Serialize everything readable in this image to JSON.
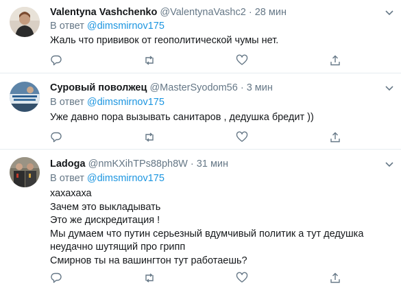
{
  "tweets": [
    {
      "name": "Valentyna Vashchenko",
      "handle": "@ValentynaVashc2",
      "dot": "·",
      "time": "28 мин",
      "reply_prefix": "В ответ",
      "reply_mention": "@dimsmirnov175",
      "text": "Жаль что прививок от геополитической чумы нет.",
      "avatar_icon": "profile-photo"
    },
    {
      "name": "Суровый поволжец",
      "handle": "@MasterSyodom56",
      "dot": "·",
      "time": "3 мин",
      "reply_prefix": "В ответ",
      "reply_mention": "@dimsmirnov175",
      "text": "Уже давно пора вызывать санитаров , дедушка бредит ))",
      "avatar_icon": "profile-photo"
    },
    {
      "name": "Ladoga",
      "handle": "@nmKXihTPs88ph8W",
      "dot": "·",
      "time": "31 мин",
      "reply_prefix": "В ответ",
      "reply_mention": "@dimsmirnov175",
      "text": "хахахаха\nЗачем это выкладывать\nЭто же дискредитация !\nМы думаем что путин серьезный вдумчивый политик а тут дедушка\nнеудачно шутящий про грипп\nСмирнов ты на вашингтон тут работаешь?",
      "avatar_icon": "profile-photo"
    }
  ],
  "icons": {
    "reply": "reply-icon",
    "retweet": "retweet-icon",
    "like": "like-icon",
    "share": "share-icon",
    "caret": "chevron-down-icon"
  },
  "colors": {
    "accent": "#1b95e0",
    "muted": "#657786",
    "divider": "#e6ecf0"
  }
}
